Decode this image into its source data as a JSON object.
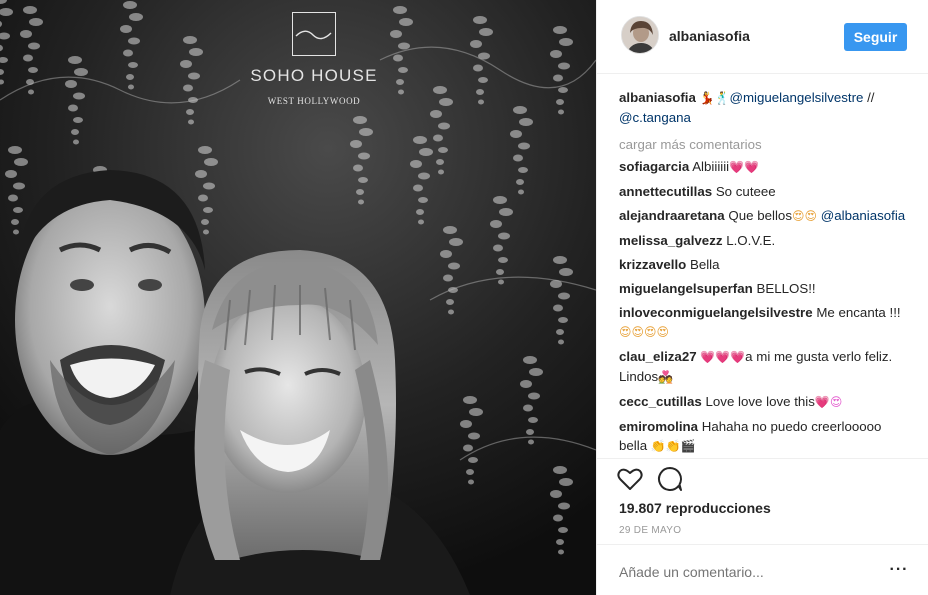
{
  "post": {
    "username": "albaniasofia",
    "follow_label": "Seguir",
    "avatar_icon": "profile-photo"
  },
  "photo": {
    "venue_name": "SOHO HOUSE",
    "venue_location": "WEST HOLLYWOOD"
  },
  "caption": {
    "username": "albaniasofia",
    "emoji": "💃🕺",
    "mention_1": "@miguelangelsilvestre",
    "separator": " //",
    "mention_2": "@c.tangana"
  },
  "load_more_label": "cargar más comentarios",
  "comments": [
    {
      "user": "sofiagarcia",
      "text": "Albiiiiii",
      "emoji": "💗💗"
    },
    {
      "user": "annettecutillas",
      "text": "So cuteee",
      "emoji": ""
    },
    {
      "user": "alejandraaretana",
      "text": "Que bellos",
      "emoji": "😍😍",
      "mention": "@albaniasofia"
    },
    {
      "user": "melissa_galvezz",
      "text": "L.O.V.E.",
      "emoji": ""
    },
    {
      "user": "krizzavello",
      "text": "Bella",
      "emoji": ""
    },
    {
      "user": "miguelangelsuperfan",
      "text": "BELLOS!!",
      "emoji": ""
    },
    {
      "user": "inloveconmiguelangelsilvestre",
      "text": "Me encanta !!!",
      "emoji": "😍😍😍😍"
    },
    {
      "user": "clau_eliza27",
      "text_before": "",
      "emoji": "💗💗💗",
      "text": "a mi me gusta verlo feliz. Lindos",
      "emoji_after": "💑"
    },
    {
      "user": "cecc_cutillas",
      "text": "Love love love this",
      "emoji": "💗😍"
    },
    {
      "user": "emiromolina",
      "text": "Hahaha no puedo creerlooooo bella",
      "emoji": "👏👏🎬"
    }
  ],
  "actions": {
    "like_icon": "heart-outline-icon",
    "comment_icon": "speech-bubble-icon"
  },
  "views": "19.807 reproducciones",
  "date": "29 DE MAYO",
  "add_comment_placeholder": "Añade un comentario...",
  "more_label": "···"
}
